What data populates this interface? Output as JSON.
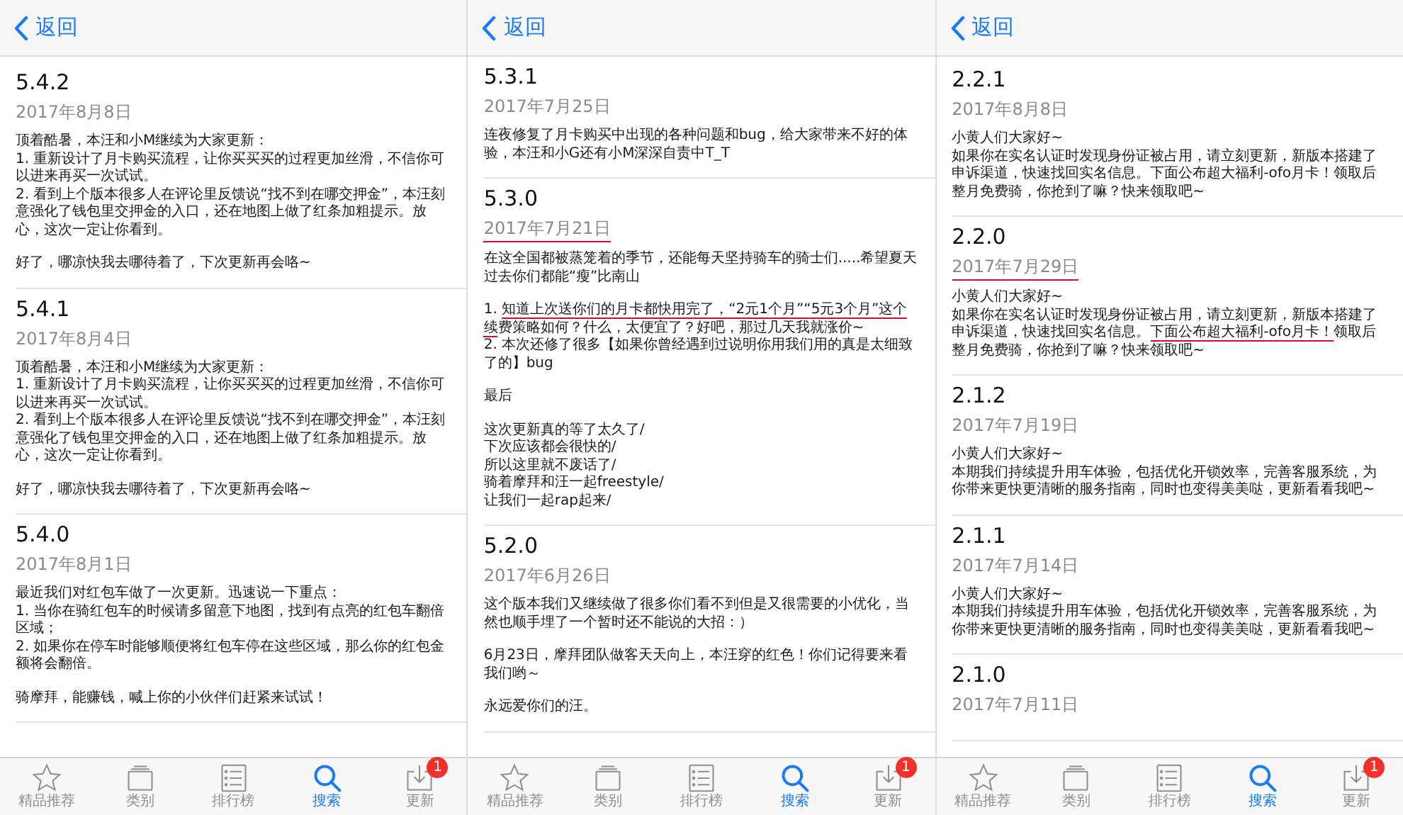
{
  "panels": [
    {
      "back_label": "返回",
      "entries": [
        {
          "version": "5.4.2",
          "date": "2017年8月8日",
          "date_underlined": false,
          "paragraphs": [
            [
              "顶着酷暑，本汪和小M继续为大家更新：",
              "1. 重新设计了月卡购买流程，让你买买买的过程更加丝滑，不信你可以进来再买一次试试。",
              "2. 看到上个版本很多人在评论里反馈说“找不到在哪交押金”，本汪刻意强化了钱包里交押金的入口，还在地图上做了红条加粗提示。放心，这次一定让你看到。"
            ],
            [
              "好了，哪凉快我去哪待着了，下次更新再会咯~"
            ]
          ]
        },
        {
          "version": "5.4.1",
          "date": "2017年8月4日",
          "date_underlined": false,
          "paragraphs": [
            [
              "顶着酷暑，本汪和小M继续为大家更新：",
              "1. 重新设计了月卡购买流程，让你买买买的过程更加丝滑，不信你可以进来再买一次试试。",
              "2. 看到上个版本很多人在评论里反馈说“找不到在哪交押金”，本汪刻意强化了钱包里交押金的入口，还在地图上做了红条加粗提示。放心，这次一定让你看到。"
            ],
            [
              "好了，哪凉快我去哪待着了，下次更新再会咯~"
            ]
          ]
        },
        {
          "version": "5.4.0",
          "date": "2017年8月1日",
          "date_underlined": false,
          "paragraphs": [
            [
              "最近我们对红包车做了一次更新。迅速说一下重点：",
              "1. 当你在骑红包车的时候请多留意下地图，找到有点亮的红包车翻倍区域；",
              "2. 如果你在停车时能够顺便将红包车停在这些区域，那么你的红包金额将会翻倍。"
            ],
            [
              "骑摩拜，能赚钱，喊上你的小伙伴们赶紧来试试！"
            ]
          ]
        }
      ],
      "tabs": [
        {
          "kind": "featured",
          "label": "精品推荐",
          "selected": false
        },
        {
          "kind": "categories",
          "label": "类别",
          "selected": false
        },
        {
          "kind": "charts",
          "label": "排行榜",
          "selected": false
        },
        {
          "kind": "search",
          "label": "搜索",
          "selected": true
        },
        {
          "kind": "updates",
          "label": "更新",
          "selected": false,
          "badge": "1"
        }
      ]
    },
    {
      "back_label": "返回",
      "entries": [
        {
          "version": "5.3.1",
          "date": "2017年7月25日",
          "date_underlined": false,
          "paragraphs": [
            [
              "连夜修复了月卡购买中出现的各种问题和bug，给大家带来不好的体验，本汪和小G还有小M深深自责中T_T"
            ]
          ]
        },
        {
          "version": "5.3.0",
          "date": "2017年7月21日",
          "date_underlined": true,
          "paragraphs": [
            [
              "在这全国都被蒸笼着的季节，还能每天坚持骑车的骑士们.....希望夏天过去你们都能“瘦”比南山"
            ],
            [
              {
                "segments": [
                  {
                    "text": "1. ",
                    "underlined": false
                  },
                  {
                    "text": "知道上次送你们的月卡都快用完了，“2元1个月”“5元3个月”这个续",
                    "underlined": true
                  },
                  {
                    "text": "费策略如何？什么，太便宜了？好吧，那过几天我就涨价~",
                    "underlined": false
                  }
                ]
              },
              "2. 本次还修了很多【如果你曾经遇到过说明你用我们用的真是太细致了的】bug"
            ],
            [
              "最后"
            ],
            [
              "这次更新真的等了太久了/",
              "下次应该都会很快的/",
              "所以这里就不废话了/",
              "骑着摩拜和汪一起freestyle/",
              "让我们一起rap起来/"
            ]
          ]
        },
        {
          "version": "5.2.0",
          "date": "2017年6月26日",
          "date_underlined": false,
          "paragraphs": [
            [
              "这个版本我们又继续做了很多你们看不到但是又很需要的小优化，当然也顺手埋了一个暂时还不能说的大招：）"
            ],
            [
              "6月23日，摩拜团队做客天天向上，本汪穿的红色！你们记得要来看我们哟～"
            ],
            [
              "永远爱你们的汪。"
            ]
          ]
        }
      ],
      "tabs": [
        {
          "kind": "featured",
          "label": "精品推荐",
          "selected": false
        },
        {
          "kind": "categories",
          "label": "类别",
          "selected": false
        },
        {
          "kind": "charts",
          "label": "排行榜",
          "selected": false
        },
        {
          "kind": "search",
          "label": "搜索",
          "selected": true
        },
        {
          "kind": "updates",
          "label": "更新",
          "selected": false,
          "badge": "1"
        }
      ]
    },
    {
      "back_label": "返回",
      "entries": [
        {
          "version": "2.2.1",
          "date": "2017年8月8日",
          "date_underlined": false,
          "paragraphs": [
            [
              "小黄人们大家好~",
              "如果你在实名认证时发现身份证被占用，请立刻更新，新版本搭建了申诉渠道，快速找回实名信息。下面公布超大福利-ofo月卡！领取后整月免费骑，你抢到了嘛？快来领取吧~"
            ]
          ]
        },
        {
          "version": "2.2.0",
          "date": "2017年7月29日",
          "date_underlined": true,
          "paragraphs": [
            [
              "小黄人们大家好~",
              {
                "segments": [
                  {
                    "text": "如果你在实名认证时发现身份证被占用，请立刻更新，新版本搭建了申诉渠道，快速找回实名信息。",
                    "underlined": false
                  },
                  {
                    "text": "下面公布超大福利-ofo月卡！",
                    "underlined": true
                  },
                  {
                    "text": "领取后整月免费骑，你抢到了嘛？快来领取吧~",
                    "underlined": false
                  }
                ]
              }
            ]
          ]
        },
        {
          "version": "2.1.2",
          "date": "2017年7月19日",
          "date_underlined": false,
          "paragraphs": [
            [
              "小黄人们大家好~",
              "本期我们持续提升用车体验，包括优化开锁效率，完善客服系统，为你带来更快更清晰的服务指南，同时也变得美美哒，更新看看我吧~"
            ]
          ]
        },
        {
          "version": "2.1.1",
          "date": "2017年7月14日",
          "date_underlined": false,
          "paragraphs": [
            [
              "小黄人们大家好~",
              "本期我们持续提升用车体验，包括优化开锁效率，完善客服系统，为你带来更快更清晰的服务指南，同时也变得美美哒，更新看看我吧~"
            ]
          ]
        },
        {
          "version": "2.1.0",
          "date": "2017年7月11日",
          "date_underlined": false
        }
      ],
      "tabs": [
        {
          "kind": "featured",
          "label": "精品推荐",
          "selected": false
        },
        {
          "kind": "categories",
          "label": "类别",
          "selected": false
        },
        {
          "kind": "charts",
          "label": "排行榜",
          "selected": false
        },
        {
          "kind": "search",
          "label": "搜索",
          "selected": true
        },
        {
          "kind": "updates",
          "label": "更新",
          "selected": false,
          "badge": "1"
        }
      ]
    }
  ]
}
